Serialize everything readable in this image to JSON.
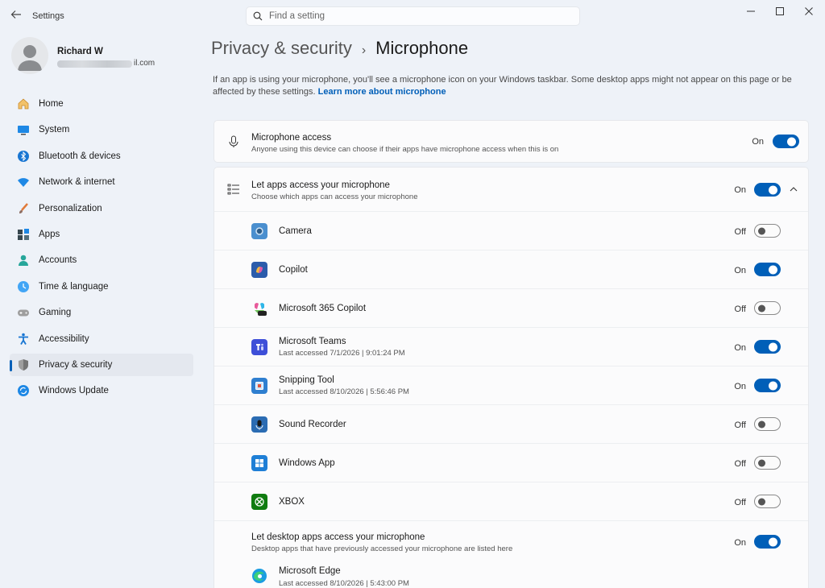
{
  "window": {
    "title": "Settings"
  },
  "search": {
    "placeholder": "Find a setting"
  },
  "profile": {
    "name": "Richard W",
    "email_suffix": "il.com"
  },
  "sidebar": {
    "items": [
      {
        "label": "Home",
        "icon": "home-icon"
      },
      {
        "label": "System",
        "icon": "system-icon"
      },
      {
        "label": "Bluetooth & devices",
        "icon": "bluetooth-icon"
      },
      {
        "label": "Network & internet",
        "icon": "network-icon"
      },
      {
        "label": "Personalization",
        "icon": "personalization-icon"
      },
      {
        "label": "Apps",
        "icon": "apps-icon"
      },
      {
        "label": "Accounts",
        "icon": "accounts-icon"
      },
      {
        "label": "Time & language",
        "icon": "time-language-icon"
      },
      {
        "label": "Gaming",
        "icon": "gaming-icon"
      },
      {
        "label": "Accessibility",
        "icon": "accessibility-icon"
      },
      {
        "label": "Privacy & security",
        "icon": "privacy-shield-icon",
        "active": true
      },
      {
        "label": "Windows Update",
        "icon": "windows-update-icon"
      }
    ]
  },
  "breadcrumb": {
    "parent": "Privacy & security",
    "separator": "›",
    "current": "Microphone"
  },
  "description": {
    "text": "If an app is using your microphone, you'll see a microphone icon on your Windows taskbar. Some desktop apps might not appear on this page or be affected by these settings.",
    "link": "Learn more about microphone"
  },
  "mic_access": {
    "title": "Microphone access",
    "subtitle": "Anyone using this device can choose if their apps have microphone access when this is on",
    "state": "On"
  },
  "apps_access": {
    "title": "Let apps access your microphone",
    "subtitle": "Choose which apps can access your microphone",
    "state": "On"
  },
  "apps": [
    {
      "name": "Camera",
      "detail": "",
      "state": "Off"
    },
    {
      "name": "Copilot",
      "detail": "",
      "state": "On"
    },
    {
      "name": "Microsoft 365 Copilot",
      "detail": "",
      "state": "Off"
    },
    {
      "name": "Microsoft Teams",
      "detail": "Last accessed 7/1/2026  |  9:01:24 PM",
      "state": "On"
    },
    {
      "name": "Snipping Tool",
      "detail": "Last accessed 8/10/2026  |  5:56:46 PM",
      "state": "On"
    },
    {
      "name": "Sound Recorder",
      "detail": "",
      "state": "Off"
    },
    {
      "name": "Windows App",
      "detail": "",
      "state": "Off"
    },
    {
      "name": "XBOX",
      "detail": "",
      "state": "Off"
    }
  ],
  "desktop_access": {
    "title": "Let desktop apps access your microphone",
    "subtitle": "Desktop apps that have previously accessed your microphone are listed here",
    "state": "On"
  },
  "desktop_apps": [
    {
      "name": "Microsoft Edge",
      "detail": "Last accessed 8/10/2026  |  5:43:00 PM"
    }
  ],
  "colors": {
    "accent": "#005fb8",
    "background": "#eef2f8",
    "card": "#fbfbfc"
  }
}
